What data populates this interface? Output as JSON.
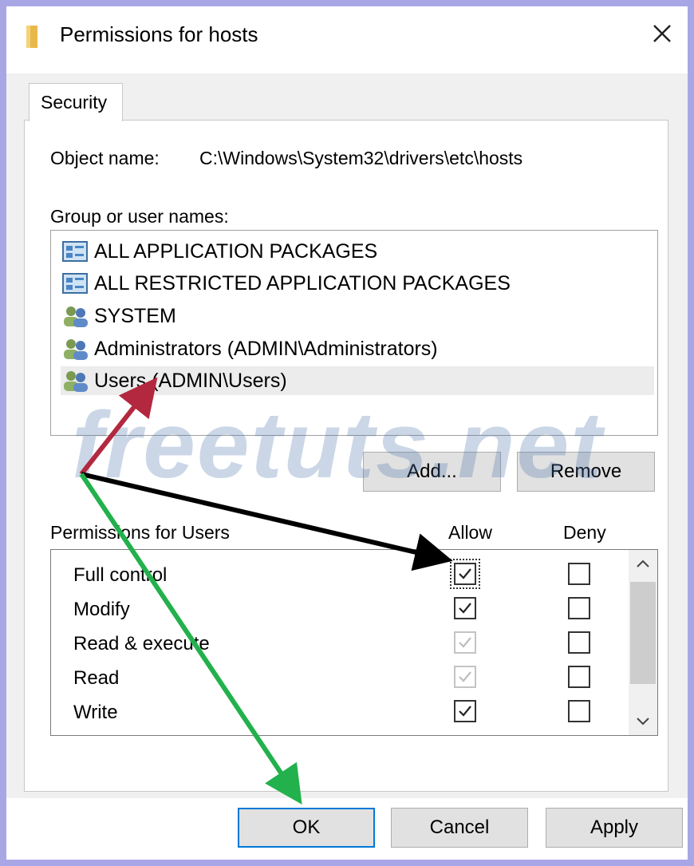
{
  "window": {
    "title": "Permissions for hosts",
    "folder_icon": "folder-icon",
    "close_icon": "close-icon"
  },
  "tabs": [
    {
      "label": "Security",
      "active": true
    }
  ],
  "object": {
    "label": "Object name:",
    "value": "C:\\Windows\\System32\\drivers\\etc\\hosts"
  },
  "groups": {
    "label": "Group or user names:",
    "items": [
      {
        "label": "ALL APPLICATION PACKAGES",
        "icon": "app-packages-icon",
        "selected": false
      },
      {
        "label": "ALL RESTRICTED APPLICATION PACKAGES",
        "icon": "app-packages-icon",
        "selected": false
      },
      {
        "label": "SYSTEM",
        "icon": "users-group-icon",
        "selected": false
      },
      {
        "label": "Administrators (ADMIN\\Administrators)",
        "icon": "users-group-icon",
        "selected": false
      },
      {
        "label": "Users (ADMIN\\Users)",
        "icon": "users-group-icon",
        "selected": true
      }
    ],
    "add_label": "Add...",
    "remove_label": "Remove"
  },
  "permissions": {
    "header": "Permissions for Users",
    "allow_header": "Allow",
    "deny_header": "Deny",
    "rows": [
      {
        "name": "Full control",
        "allow": "checked",
        "deny": "unchecked"
      },
      {
        "name": "Modify",
        "allow": "checked",
        "deny": "unchecked"
      },
      {
        "name": "Read & execute",
        "allow": "checked-disabled",
        "deny": "unchecked"
      },
      {
        "name": "Read",
        "allow": "checked-disabled",
        "deny": "unchecked"
      },
      {
        "name": "Write",
        "allow": "checked",
        "deny": "unchecked"
      }
    ]
  },
  "footer": {
    "ok_label": "OK",
    "cancel_label": "Cancel",
    "apply_label": "Apply"
  },
  "watermark": {
    "text": "freetuts.net"
  },
  "colors": {
    "frame": "#a9a6e6",
    "accent": "#0078d7",
    "arrow_red": "#b3283f",
    "arrow_black": "#000000",
    "arrow_green": "#22b14c"
  }
}
